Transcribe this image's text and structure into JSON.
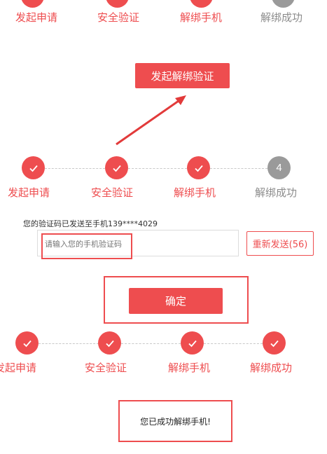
{
  "top_steps": {
    "labels": [
      "发起申请",
      "安全验证",
      "解绑手机",
      "解绑成功"
    ]
  },
  "init_button": {
    "label": "发起解绑验证"
  },
  "steps": [
    {
      "label": "发起申请",
      "state": "done"
    },
    {
      "label": "安全验证",
      "state": "done"
    },
    {
      "label": "解绑手机",
      "state": "done"
    },
    {
      "label": "解绑成功",
      "state": "pending",
      "number": "4"
    }
  ],
  "verify": {
    "sent_notice": "您的验证码已发送至手机139****4029",
    "code_placeholder": "请输入您的手机验证码",
    "resend_label": "重新发送(56)",
    "confirm_label": "确定"
  },
  "final_steps": [
    {
      "label": "发起申请",
      "state": "done"
    },
    {
      "label": "安全验证",
      "state": "done"
    },
    {
      "label": "解绑手机",
      "state": "done"
    },
    {
      "label": "解绑成功",
      "state": "done"
    }
  ],
  "success": {
    "message": "您已成功解绑手机!"
  },
  "colors": {
    "accent": "#ee4d4f",
    "pending": "#9a9a9a",
    "muted": "#8c8c8c"
  }
}
